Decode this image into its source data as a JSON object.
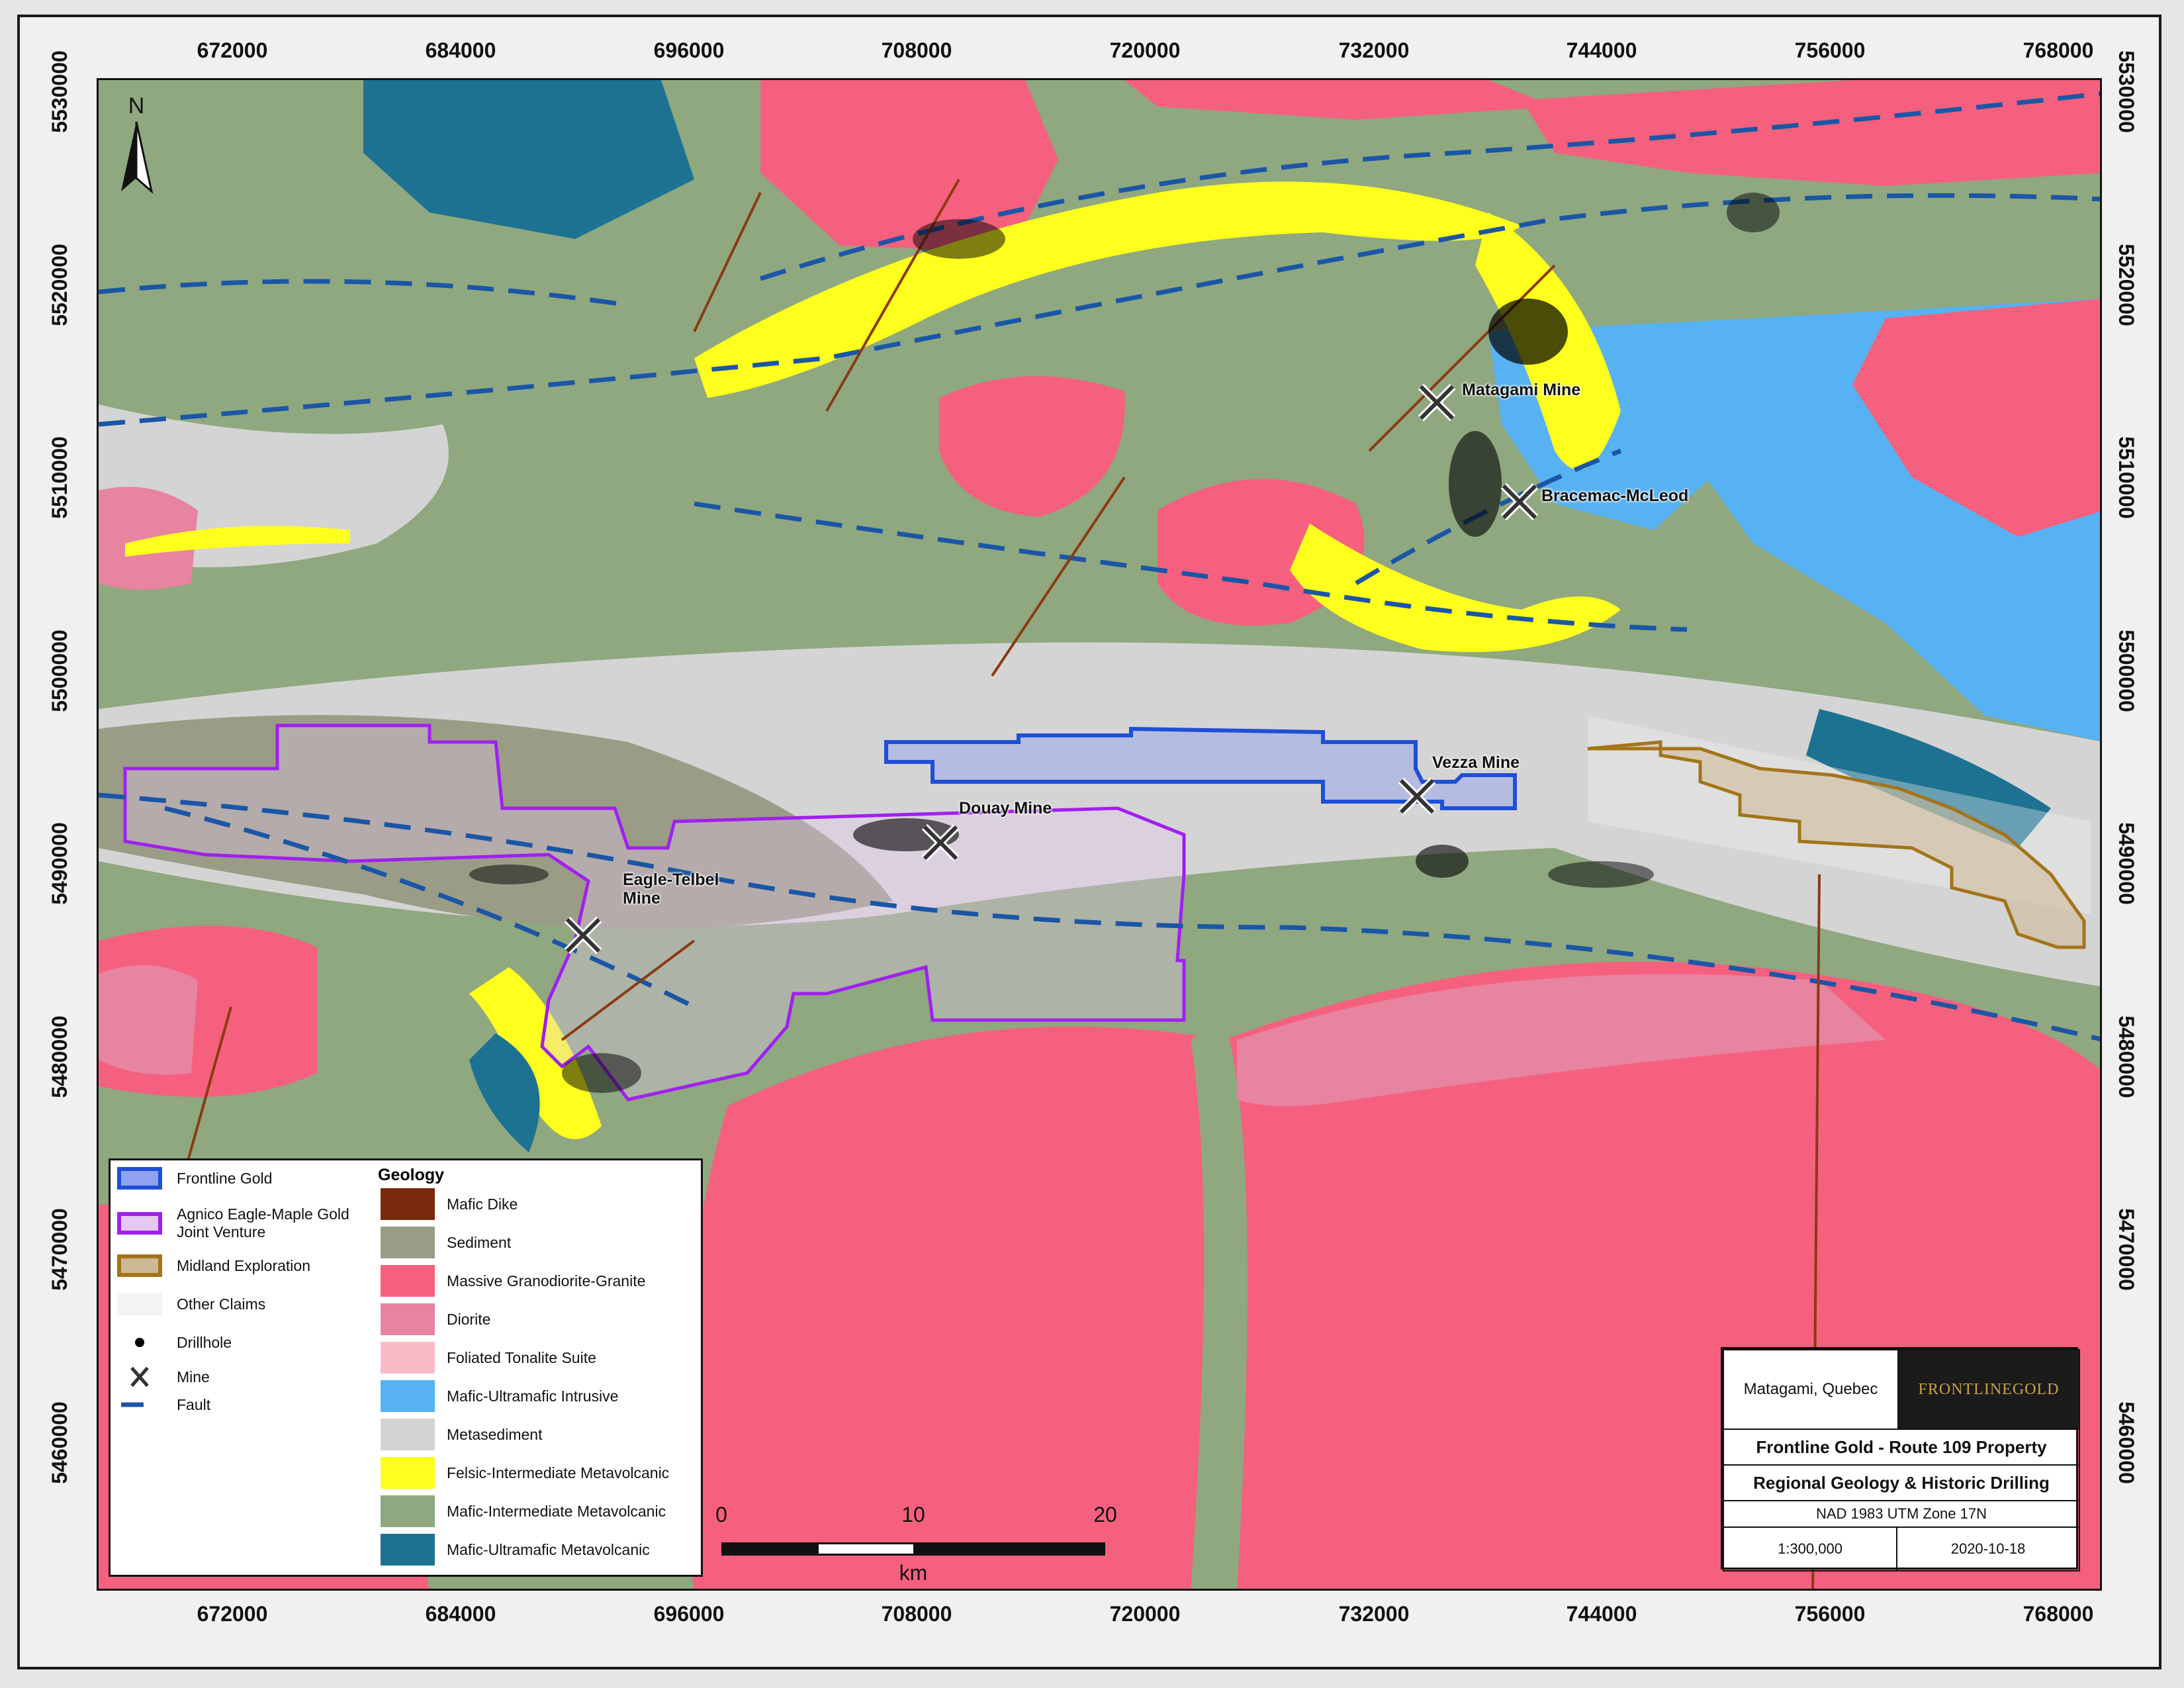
{
  "map": {
    "x_ticks": [
      "672000",
      "684000",
      "696000",
      "708000",
      "720000",
      "732000",
      "744000",
      "756000",
      "768000"
    ],
    "y_ticks": [
      "5530000",
      "5520000",
      "5510000",
      "5500000",
      "5490000",
      "5480000",
      "5470000",
      "5460000"
    ],
    "north_label": "N",
    "mines": [
      {
        "name": "Matagami Mine"
      },
      {
        "name": "Bracemac-McLeod"
      },
      {
        "name": "Vezza Mine"
      },
      {
        "name": "Douay Mine"
      },
      {
        "name": "Eagle-Telbel\nMine"
      }
    ]
  },
  "legend": {
    "claims": [
      {
        "label": "Frontline Gold",
        "fill": "#8fa2f0",
        "stroke": "#1f4fd6"
      },
      {
        "label": "Agnico Eagle-Maple Gold\nJoint Venture",
        "fill": "#e4c8f2",
        "stroke": "#a020f0"
      },
      {
        "label": "Midland Exploration",
        "fill": "#cdb894",
        "stroke": "#a3741a"
      },
      {
        "label": "Other Claims",
        "fill": "#f3f3f3",
        "stroke": "#f3f3f3"
      }
    ],
    "drillhole_label": "Drillhole",
    "mine_label": "Mine",
    "fault_label": "Fault",
    "geology_title": "Geology",
    "geology": [
      {
        "label": "Mafic Dike",
        "color": "#7a2a0c"
      },
      {
        "label": "Sediment",
        "color": "#9b9c86"
      },
      {
        "label": "Massive Granodiorite-Granite",
        "color": "#f5607e"
      },
      {
        "label": "Diorite",
        "color": "#e7849f"
      },
      {
        "label": "Foliated Tonalite Suite",
        "color": "#f8bcc7"
      },
      {
        "label": "Mafic-Ultramafic Intrusive",
        "color": "#56b2f2"
      },
      {
        "label": "Metasediment",
        "color": "#d4d4d4"
      },
      {
        "label": "Felsic-Intermediate Metavolcanic",
        "color": "#ffff1e"
      },
      {
        "label": "Mafic-Intermediate Metavolcanic",
        "color": "#8fa880"
      },
      {
        "label": "Mafic-Ultramafic Metavolcanic",
        "color": "#1e7291"
      }
    ]
  },
  "scalebar": {
    "labels": [
      "0",
      "10",
      "20"
    ],
    "unit": "km"
  },
  "titlebox": {
    "location": "Matagami, Quebec",
    "logo_text": "FRONTLINEGOLD",
    "title_line1": "Frontline Gold - Route 109 Property",
    "title_line2": "Regional Geology & Historic Drilling",
    "datum": "NAD 1983 UTM Zone 17N",
    "scale": "1:300,000",
    "date": "2020-10-18"
  }
}
